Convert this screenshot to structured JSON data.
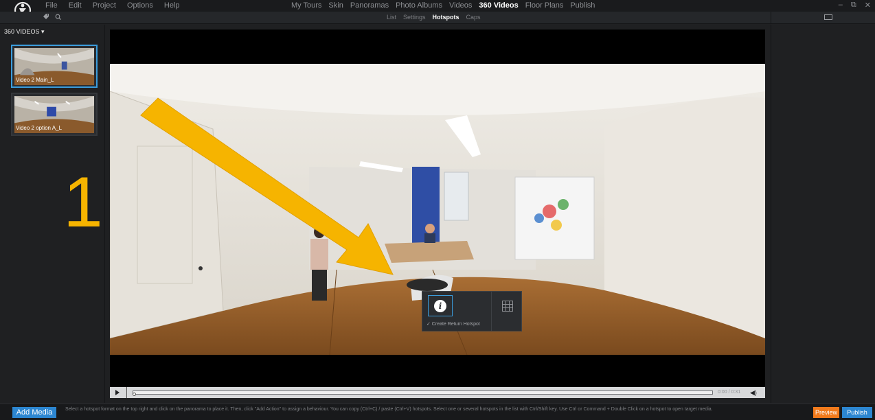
{
  "menubar": {
    "items": [
      "File",
      "Edit",
      "Project",
      "Options",
      "Help"
    ],
    "sections": [
      "My Tours",
      "Skin",
      "Panoramas",
      "Photo Albums",
      "Videos",
      "360 Videos",
      "Floor Plans",
      "Publish"
    ],
    "active_section": "360 Videos"
  },
  "subtabs": {
    "items": [
      "List",
      "Settings",
      "Hotspots",
      "Caps"
    ],
    "active": "Hotspots"
  },
  "sidebar": {
    "dropdown_label": "360 VIDEOS ▾",
    "videos": [
      {
        "label": "Video 2 Main_L",
        "selected": true
      },
      {
        "label": "Video 2 option A_L",
        "selected": false
      }
    ]
  },
  "annotation": {
    "number": "1",
    "color": "#f6b400"
  },
  "popup": {
    "info_glyph": "i",
    "return_hotspot_label": "✓ Create Return Hotspot"
  },
  "player": {
    "timecode": "0:00 / 0:31",
    "volume_glyph": "◀)"
  },
  "bottombar": {
    "add_media": "Add Media",
    "status": "Select a hotspot format on the top right and click on the panorama to place it. Then, click \"Add Action\" to assign a behaviour. You can copy (Ctrl+C) / paste (Ctrl+V) hotspots. Select one or several hotspots in the list with Ctrl/Shift key. Use Ctrl or Command + Double Click on a hotspot to open target media.",
    "preview": "Preview",
    "publish": "Publish"
  },
  "colors": {
    "accent_blue": "#2c86d1",
    "selection_blue": "#3b9ddd",
    "preview_orange": "#f17a1c"
  }
}
